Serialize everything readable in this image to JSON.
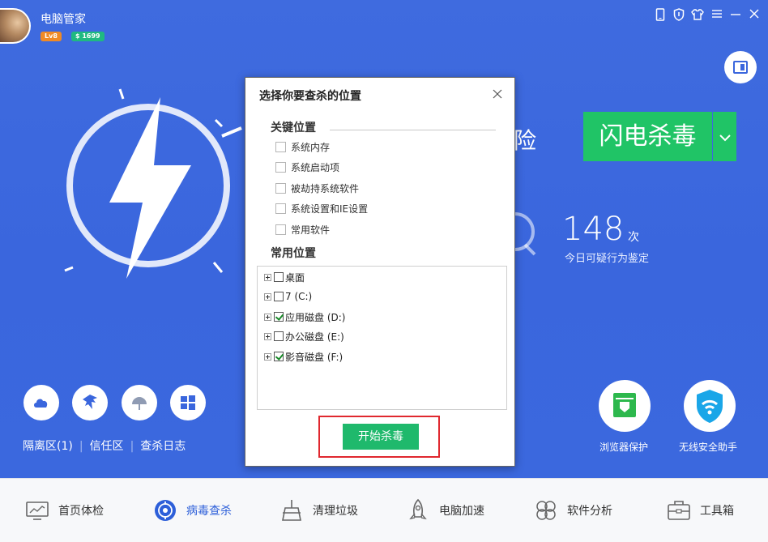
{
  "app": {
    "title": "电脑管家",
    "level": "Lv8",
    "coins": "$ 1699"
  },
  "window_controls": [
    "phone-icon",
    "shield-icon",
    "shirt-icon",
    "menu-icon",
    "minimize-icon",
    "close-icon"
  ],
  "main": {
    "headline_fragment": "险",
    "scan_button": "闪电杀毒",
    "scan_dropdown": "⌄",
    "stat_value": "148",
    "stat_unit": "次",
    "stat_label": "今日可疑行为鉴定"
  },
  "left_tools": {
    "links": [
      "隔离区(1)",
      "信任区",
      "查杀日志"
    ]
  },
  "features": [
    {
      "label": "浏览器保护"
    },
    {
      "label": "无线安全助手"
    }
  ],
  "dialog": {
    "title": "选择你要查杀的位置",
    "key_section": "关键位置",
    "key_items": [
      "系统内存",
      "系统启动项",
      "被劫持系统软件",
      "系统设置和IE设置",
      "常用软件"
    ],
    "common_section": "常用位置",
    "tree_items": [
      {
        "label": "桌面",
        "checked": false
      },
      {
        "label": "7 (C:)",
        "checked": false
      },
      {
        "label": "应用磁盘 (D:)",
        "checked": true
      },
      {
        "label": "办公磁盘 (E:)",
        "checked": false
      },
      {
        "label": "影音磁盘 (F:)",
        "checked": true
      }
    ],
    "start_button": "开始杀毒"
  },
  "nav": [
    {
      "label": "首页体检",
      "icon": "monitor-icon"
    },
    {
      "label": "病毒查杀",
      "icon": "virus-scan-icon",
      "active": true
    },
    {
      "label": "清理垃圾",
      "icon": "broom-icon"
    },
    {
      "label": "电脑加速",
      "icon": "rocket-icon"
    },
    {
      "label": "软件分析",
      "icon": "clover-icon"
    },
    {
      "label": "工具箱",
      "icon": "toolbox-icon"
    }
  ],
  "colors": {
    "primary_blue": "#3a66dd",
    "green": "#20c466",
    "highlight_red": "#e0282f"
  }
}
